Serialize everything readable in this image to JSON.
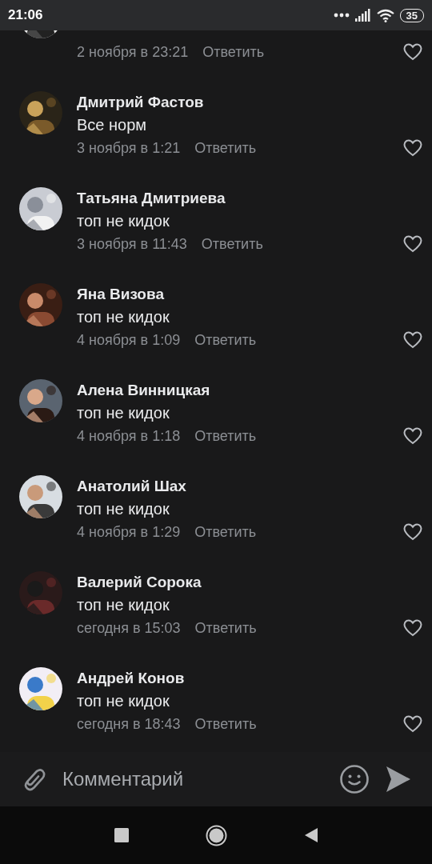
{
  "status_bar": {
    "time": "21:06",
    "battery": "35"
  },
  "comments": [
    {
      "date": "2 ноября в 23:21",
      "reply": "Ответить",
      "liked": false
    },
    {
      "name": "Дмитрий Фастов",
      "text": "Все норм",
      "date": "3 ноября в 1:21",
      "reply": "Ответить",
      "liked": false
    },
    {
      "name": "Татьяна Дмитриева",
      "text": "топ не кидок",
      "date": "3 ноября в 11:43",
      "reply": "Ответить",
      "liked": false
    },
    {
      "name": "Яна Визова",
      "text": "топ не кидок",
      "date": "4 ноября в 1:09",
      "reply": "Ответить",
      "liked": false
    },
    {
      "name": "Алена Винницкая",
      "text": "топ не кидок",
      "date": "4 ноября в 1:18",
      "reply": "Ответить",
      "liked": false
    },
    {
      "name": "Анатолий Шах",
      "text": "топ не кидок",
      "date": "4 ноября в 1:29",
      "reply": "Ответить",
      "liked": false
    },
    {
      "name": "Валерий Сорока",
      "text": "топ не кидок",
      "date": "сегодня в 15:03",
      "reply": "Ответить",
      "liked": false
    },
    {
      "name": "Андрей Конов",
      "text": "топ не кидок",
      "date": "сегодня в 18:43",
      "reply": "Ответить",
      "liked": false
    }
  ],
  "composer": {
    "placeholder": "Комментарий"
  }
}
